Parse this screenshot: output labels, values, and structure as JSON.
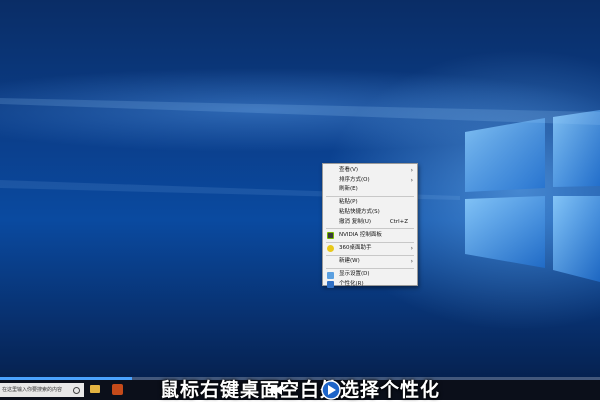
{
  "context_menu": {
    "items": [
      {
        "label": "查看(V)",
        "has_submenu": true
      },
      {
        "label": "排序方式(O)",
        "has_submenu": true
      },
      {
        "label": "刷新(E)",
        "has_submenu": false
      },
      {
        "label": "粘贴(P)",
        "has_submenu": false
      },
      {
        "label": "粘贴快捷方式(S)",
        "has_submenu": false
      },
      {
        "label": "撤消 复制(U)",
        "shortcut": "Ctrl+Z"
      },
      {
        "label": "NVIDIA 控制面板",
        "icon": "nvidia-icon"
      },
      {
        "label": "360桌面助手",
        "icon": "360-icon",
        "has_submenu": true
      },
      {
        "label": "新建(W)",
        "has_submenu": true
      },
      {
        "label": "显示设置(D)",
        "icon": "display-icon"
      },
      {
        "label": "个性化(R)",
        "icon": "personalize-icon"
      }
    ]
  },
  "taskbar": {
    "search_placeholder": "在这里输入你要搜索的内容"
  },
  "video": {
    "caption": "鼠标右键桌面空白处选择个性化",
    "progress": 0.22
  },
  "colors": {
    "menu_bg": "#f2f2f2",
    "progress_accent": "#4aa3ff"
  }
}
